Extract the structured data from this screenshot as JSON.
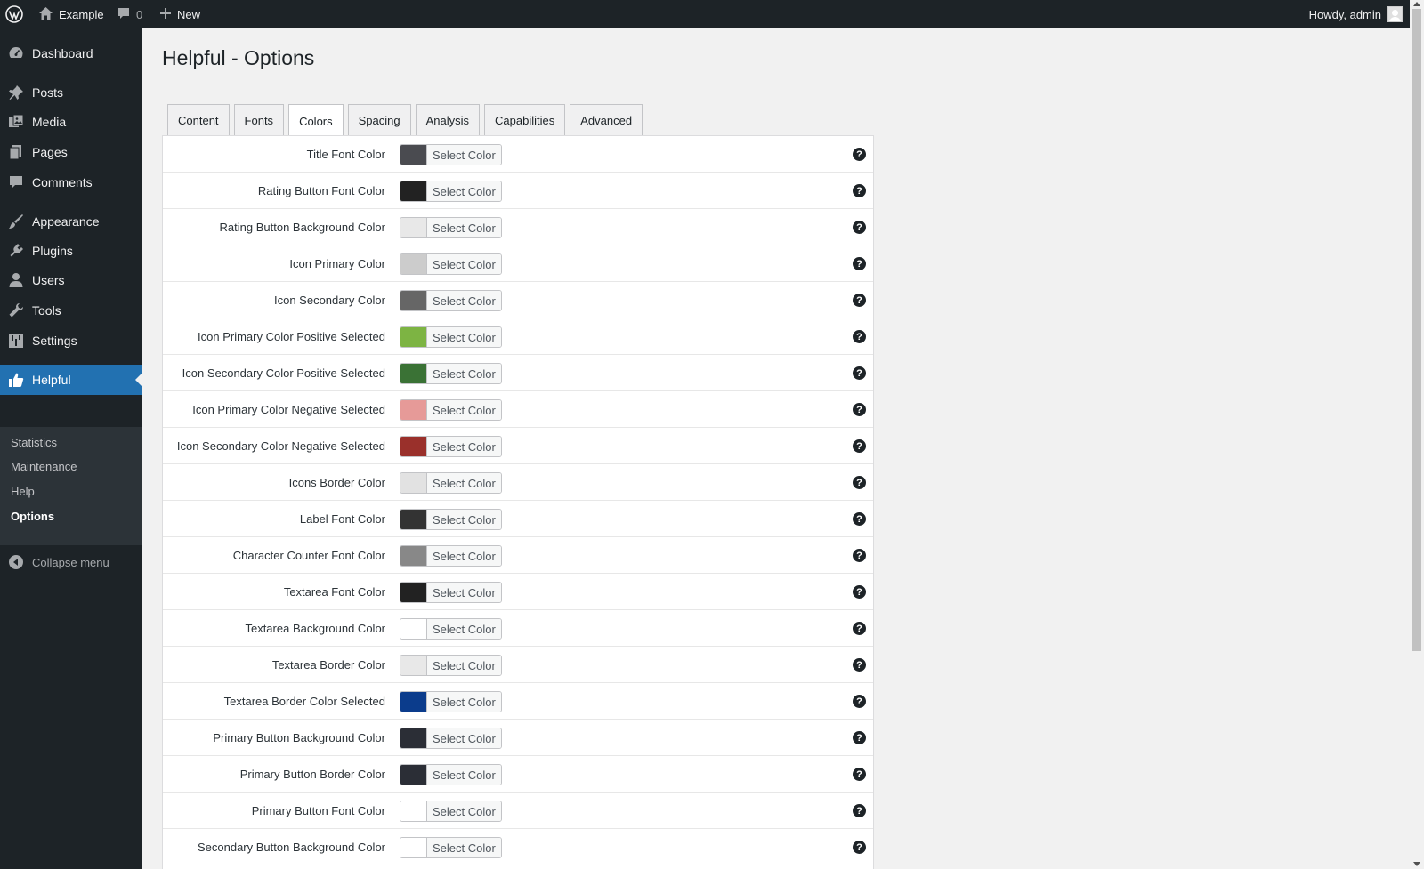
{
  "adminbar": {
    "site_name": "Example",
    "comments_count": "0",
    "new_label": "New",
    "howdy": "Howdy, admin"
  },
  "sidebar": {
    "items": [
      {
        "label": "Dashboard",
        "icon": "dashboard-icon"
      },
      {
        "label": "Posts",
        "icon": "pin-icon"
      },
      {
        "label": "Media",
        "icon": "media-icon"
      },
      {
        "label": "Pages",
        "icon": "pages-icon"
      },
      {
        "label": "Comments",
        "icon": "comment-icon"
      },
      {
        "label": "Appearance",
        "icon": "brush-icon"
      },
      {
        "label": "Plugins",
        "icon": "plugin-icon"
      },
      {
        "label": "Users",
        "icon": "user-icon"
      },
      {
        "label": "Tools",
        "icon": "wrench-icon"
      },
      {
        "label": "Settings",
        "icon": "settings-icon"
      },
      {
        "label": "Helpful",
        "icon": "thumbs-up-icon"
      }
    ],
    "submenu": [
      "Statistics",
      "Maintenance",
      "Help",
      "Options"
    ],
    "collapse_label": "Collapse menu"
  },
  "page": {
    "title": "Helpful - Options"
  },
  "tabs": [
    "Content",
    "Fonts",
    "Colors",
    "Spacing",
    "Analysis",
    "Capabilities",
    "Advanced"
  ],
  "active_tab": "Colors",
  "select_color_label": "Select Color",
  "color_rows": [
    {
      "label": "Title Font Color",
      "color": "#4a4b50"
    },
    {
      "label": "Rating Button Font Color",
      "color": "#222222"
    },
    {
      "label": "Rating Button Background Color",
      "color": "#e8e8e8"
    },
    {
      "label": "Icon Primary Color",
      "color": "#cccccc"
    },
    {
      "label": "Icon Secondary Color",
      "color": "#666666"
    },
    {
      "label": "Icon Primary Color Positive Selected",
      "color": "#7db443"
    },
    {
      "label": "Icon Secondary Color Positive Selected",
      "color": "#3a7235"
    },
    {
      "label": "Icon Primary Color Negative Selected",
      "color": "#e69a98"
    },
    {
      "label": "Icon Secondary Color Negative Selected",
      "color": "#9a302b"
    },
    {
      "label": "Icons Border Color",
      "color": "#e2e2e2"
    },
    {
      "label": "Label Font Color",
      "color": "#333333"
    },
    {
      "label": "Character Counter Font Color",
      "color": "#888888"
    },
    {
      "label": "Textarea Font Color",
      "color": "#222222"
    },
    {
      "label": "Textarea Background Color",
      "color": "#ffffff"
    },
    {
      "label": "Textarea Border Color",
      "color": "#e8e8e8"
    },
    {
      "label": "Textarea Border Color Selected",
      "color": "#0b3c8c"
    },
    {
      "label": "Primary Button Background Color",
      "color": "#2b2e36"
    },
    {
      "label": "Primary Button Border Color",
      "color": "#2b2e36"
    },
    {
      "label": "Primary Button Font Color",
      "color": "#ffffff"
    },
    {
      "label": "Secondary Button Background Color",
      "color": "#ffffff"
    }
  ],
  "colors": {
    "admin_dark": "#1d2327",
    "submenu_bg": "#2c3338",
    "accent": "#2271b1"
  }
}
